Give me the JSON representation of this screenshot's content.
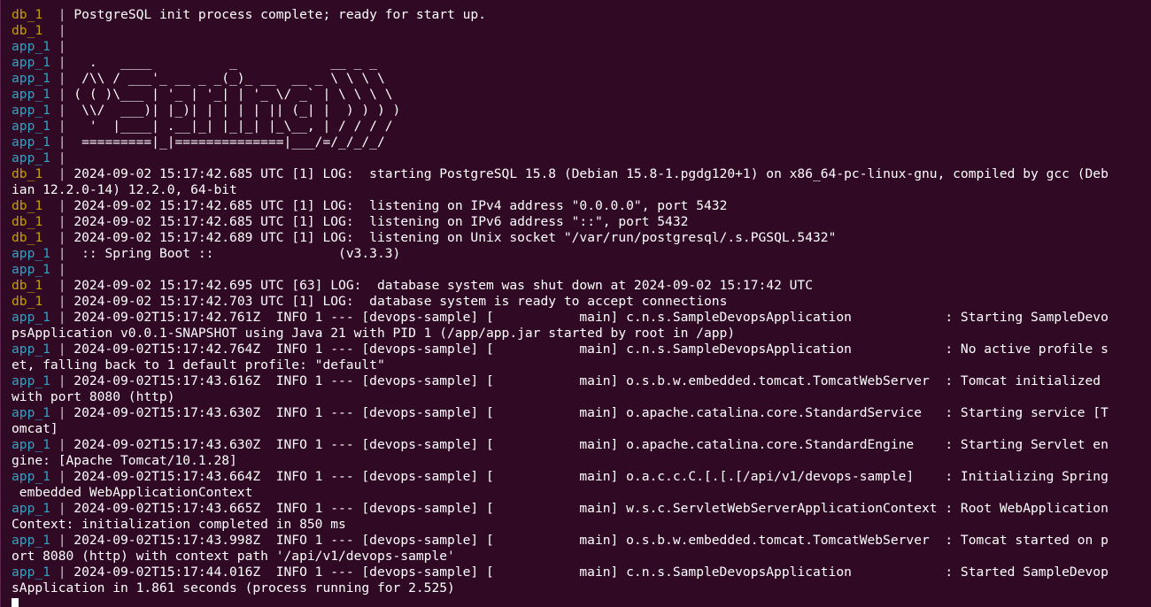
{
  "colors": {
    "background": "#300a24",
    "text": "#ffffff",
    "db_prefix": "#c4a000",
    "app_prefix": "#34a0c4"
  },
  "lines": [
    {
      "prefix": "db_1",
      "sep": "  | ",
      "text": "PostgreSQL init process complete; ready for start up."
    },
    {
      "prefix": "db_1",
      "sep": "  | ",
      "text": ""
    },
    {
      "prefix": "app_1",
      "sep": " | ",
      "text": ""
    },
    {
      "prefix": "app_1",
      "sep": " | ",
      "text": "  .   ____          _            __ _ _"
    },
    {
      "prefix": "app_1",
      "sep": " | ",
      "text": " /\\\\ / ___'_ __ _ _(_)_ __  __ _ \\ \\ \\ \\"
    },
    {
      "prefix": "app_1",
      "sep": " | ",
      "text": "( ( )\\___ | '_ | '_| | '_ \\/ _` | \\ \\ \\ \\"
    },
    {
      "prefix": "app_1",
      "sep": " | ",
      "text": " \\\\/  ___)| |_)| | | | | || (_| |  ) ) ) )"
    },
    {
      "prefix": "app_1",
      "sep": " | ",
      "text": "  '  |____| .__|_| |_|_| |_\\__, | / / / /"
    },
    {
      "prefix": "app_1",
      "sep": " | ",
      "text": " =========|_|==============|___/=/_/_/_/"
    },
    {
      "prefix": "app_1",
      "sep": " | ",
      "text": ""
    },
    {
      "prefix": "db_1",
      "sep": "  | ",
      "text": "2024-09-02 15:17:42.685 UTC [1] LOG:  starting PostgreSQL 15.8 (Debian 15.8-1.pgdg120+1) on x86_64-pc-linux-gnu, compiled by gcc (Deb"
    },
    {
      "prefix": "",
      "sep": "",
      "text": "ian 12.2.0-14) 12.2.0, 64-bit"
    },
    {
      "prefix": "db_1",
      "sep": "  | ",
      "text": "2024-09-02 15:17:42.685 UTC [1] LOG:  listening on IPv4 address \"0.0.0.0\", port 5432"
    },
    {
      "prefix": "db_1",
      "sep": "  | ",
      "text": "2024-09-02 15:17:42.685 UTC [1] LOG:  listening on IPv6 address \"::\", port 5432"
    },
    {
      "prefix": "db_1",
      "sep": "  | ",
      "text": "2024-09-02 15:17:42.689 UTC [1] LOG:  listening on Unix socket \"/var/run/postgresql/.s.PGSQL.5432\""
    },
    {
      "prefix": "app_1",
      "sep": " | ",
      "text": " :: Spring Boot ::                (v3.3.3)"
    },
    {
      "prefix": "app_1",
      "sep": " | ",
      "text": ""
    },
    {
      "prefix": "db_1",
      "sep": "  | ",
      "text": "2024-09-02 15:17:42.695 UTC [63] LOG:  database system was shut down at 2024-09-02 15:17:42 UTC"
    },
    {
      "prefix": "db_1",
      "sep": "  | ",
      "text": "2024-09-02 15:17:42.703 UTC [1] LOG:  database system is ready to accept connections"
    },
    {
      "prefix": "app_1",
      "sep": " | ",
      "text": "2024-09-02T15:17:42.761Z  INFO 1 --- [devops-sample] [           main] c.n.s.SampleDevopsApplication            : Starting SampleDevo"
    },
    {
      "prefix": "",
      "sep": "",
      "text": "psApplication v0.0.1-SNAPSHOT using Java 21 with PID 1 (/app/app.jar started by root in /app)"
    },
    {
      "prefix": "app_1",
      "sep": " | ",
      "text": "2024-09-02T15:17:42.764Z  INFO 1 --- [devops-sample] [           main] c.n.s.SampleDevopsApplication            : No active profile s"
    },
    {
      "prefix": "",
      "sep": "",
      "text": "et, falling back to 1 default profile: \"default\""
    },
    {
      "prefix": "app_1",
      "sep": " | ",
      "text": "2024-09-02T15:17:43.616Z  INFO 1 --- [devops-sample] [           main] o.s.b.w.embedded.tomcat.TomcatWebServer  : Tomcat initialized "
    },
    {
      "prefix": "",
      "sep": "",
      "text": "with port 8080 (http)"
    },
    {
      "prefix": "app_1",
      "sep": " | ",
      "text": "2024-09-02T15:17:43.630Z  INFO 1 --- [devops-sample] [           main] o.apache.catalina.core.StandardService   : Starting service [T"
    },
    {
      "prefix": "",
      "sep": "",
      "text": "omcat]"
    },
    {
      "prefix": "app_1",
      "sep": " | ",
      "text": "2024-09-02T15:17:43.630Z  INFO 1 --- [devops-sample] [           main] o.apache.catalina.core.StandardEngine    : Starting Servlet en"
    },
    {
      "prefix": "",
      "sep": "",
      "text": "gine: [Apache Tomcat/10.1.28]"
    },
    {
      "prefix": "app_1",
      "sep": " | ",
      "text": "2024-09-02T15:17:43.664Z  INFO 1 --- [devops-sample] [           main] o.a.c.c.C.[.[.[/api/v1/devops-sample]    : Initializing Spring"
    },
    {
      "prefix": "",
      "sep": "",
      "text": " embedded WebApplicationContext"
    },
    {
      "prefix": "app_1",
      "sep": " | ",
      "text": "2024-09-02T15:17:43.665Z  INFO 1 --- [devops-sample] [           main] w.s.c.ServletWebServerApplicationContext : Root WebApplication"
    },
    {
      "prefix": "",
      "sep": "",
      "text": "Context: initialization completed in 850 ms"
    },
    {
      "prefix": "app_1",
      "sep": " | ",
      "text": "2024-09-02T15:17:43.998Z  INFO 1 --- [devops-sample] [           main] o.s.b.w.embedded.tomcat.TomcatWebServer  : Tomcat started on p"
    },
    {
      "prefix": "",
      "sep": "",
      "text": "ort 8080 (http) with context path '/api/v1/devops-sample'"
    },
    {
      "prefix": "app_1",
      "sep": " | ",
      "text": "2024-09-02T15:17:44.016Z  INFO 1 --- [devops-sample] [           main] c.n.s.SampleDevopsApplication            : Started SampleDevop"
    },
    {
      "prefix": "",
      "sep": "",
      "text": "sApplication in 1.861 seconds (process running for 2.525)"
    }
  ]
}
